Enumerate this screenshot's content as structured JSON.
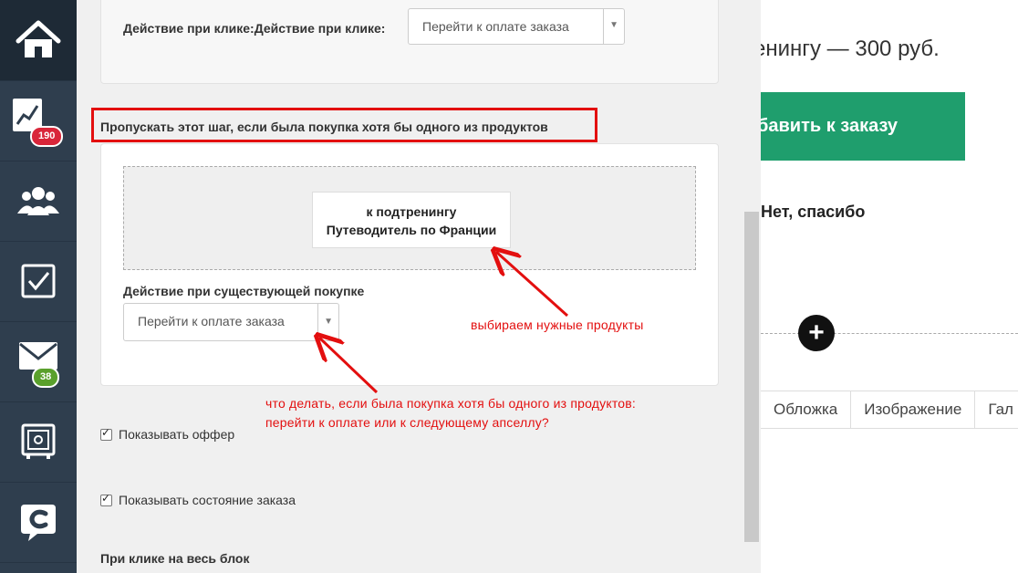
{
  "sidebar": {
    "items": [
      {
        "icon": "home-icon"
      },
      {
        "icon": "chart-icon",
        "badge": "190",
        "badge_color": "#d9263a"
      },
      {
        "icon": "users-icon"
      },
      {
        "icon": "checkbox-icon"
      },
      {
        "icon": "mail-icon",
        "badge": "38",
        "badge_color": "#5aa02c"
      },
      {
        "icon": "safe-icon"
      },
      {
        "icon": "chat-icon"
      }
    ]
  },
  "panel": {
    "click_action_label": "Действие при клике:Действие при клике:",
    "click_action_value": "Перейти к оплате заказа",
    "skip_step_label": "Пропускать этот шаг, если была покупка хотя бы одного из продуктов",
    "product_line1": "к подтренингу",
    "product_line2": "Путеводитель по Франции",
    "existing_purchase_label": "Действие при существующей покупке",
    "existing_purchase_value": "Перейти к оплате заказа",
    "show_offer_label": "Показывать оффер",
    "show_order_state_label": "Показывать состояние заказа",
    "click_whole_block_label": "При клике на весь блок"
  },
  "annotations": {
    "choose_products": "выбираем нужные продукты",
    "what_to_do_line1": "что делать, если была покупка хотя бы одного из продуктов:",
    "what_to_do_line2": "перейти к оплате или к следующему апселлу?"
  },
  "page_right": {
    "price_text": "енингу — 300 руб.",
    "add_button": "бавить к заказу",
    "no_thanks": "Нет, спасибо",
    "tabs": [
      "Обложка",
      "Изображение",
      "Гал"
    ]
  },
  "colors": {
    "sidebar_bg": "#2f3e4e",
    "accent_green": "#1f9e6d",
    "annotation_red": "#e30f0f"
  }
}
